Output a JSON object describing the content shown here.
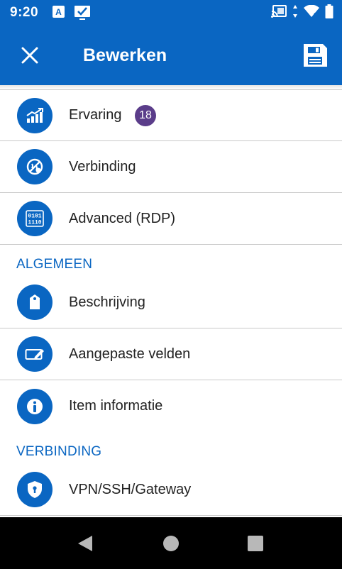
{
  "status_bar": {
    "time": "9:20",
    "notification_letter": "A",
    "icons": [
      "a-icon",
      "check-board-icon",
      "cast-icon",
      "data-arrows-icon",
      "wifi-icon",
      "battery-icon"
    ]
  },
  "toolbar": {
    "title": "Bewerken",
    "close_icon": "close-icon",
    "save_icon": "save-icon"
  },
  "items_top": [
    {
      "label": "Ervaring",
      "icon": "chart-growth-icon",
      "badge": "18"
    },
    {
      "label": "Verbinding",
      "icon": "connection-globe-icon"
    },
    {
      "label": "Advanced (RDP)",
      "icon": "binary-icon"
    }
  ],
  "sections": {
    "general": "ALGEMEEN",
    "connection": "VERBINDING"
  },
  "items_general": [
    {
      "label": "Beschrijving",
      "icon": "tag-icon"
    },
    {
      "label": "Aangepaste velden",
      "icon": "edit-field-icon"
    },
    {
      "label": "Item informatie",
      "icon": "info-icon"
    }
  ],
  "items_connection": [
    {
      "label": "VPN/SSH/Gateway",
      "icon": "shield-icon"
    }
  ],
  "colors": {
    "primary": "#0a66c2",
    "badge": "#5b3d8a",
    "divider": "#c9c9c9"
  },
  "nav_bar": {
    "icons": [
      "back-icon",
      "home-icon",
      "recents-icon"
    ]
  }
}
